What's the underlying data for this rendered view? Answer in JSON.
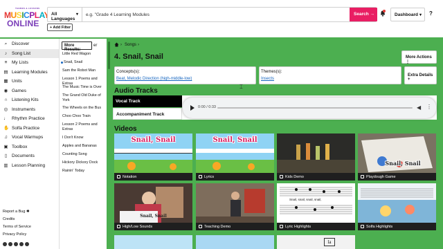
{
  "header": {
    "logo_small": "THEMES & LESSONS",
    "logo_line1": [
      "M",
      "U",
      "S",
      "I",
      "C",
      "P",
      "L",
      "A",
      "Y"
    ],
    "logo_line2": "ONLINE",
    "language": "All Languages",
    "search_value": "e.g. \"Grade 4 Learning Modules",
    "search_button": "Search →",
    "add_filter": "+ Add Filter",
    "dashboard": "Dashboard",
    "help": "?"
  },
  "sidebar": {
    "items": [
      {
        "label": "Discover",
        "icon": "search-icon",
        "glyph": "⌕"
      },
      {
        "label": "Song List",
        "icon": "music-note-icon",
        "glyph": "♪"
      },
      {
        "label": "My Lists",
        "icon": "list-icon",
        "glyph": "≡"
      },
      {
        "label": "Learning Modules",
        "icon": "modules-icon",
        "glyph": "▤"
      },
      {
        "label": "Units",
        "icon": "units-icon",
        "glyph": "▦"
      },
      {
        "label": "Games",
        "icon": "gamepad-icon",
        "glyph": "◉"
      },
      {
        "label": "Listening Kits",
        "icon": "headphones-icon",
        "glyph": "∩"
      },
      {
        "label": "Instruments",
        "icon": "drum-icon",
        "glyph": "◎"
      },
      {
        "label": "Rhythm Practice",
        "icon": "rhythm-icon",
        "glyph": "♩"
      },
      {
        "label": "Solfa Practice",
        "icon": "hand-icon",
        "glyph": "✋"
      },
      {
        "label": "Vocal Warmups",
        "icon": "microphone-icon",
        "glyph": "♫"
      },
      {
        "label": "Toolbox",
        "icon": "toolbox-icon",
        "glyph": "▣"
      },
      {
        "label": "Documents",
        "icon": "document-icon",
        "glyph": "▯"
      },
      {
        "label": "Lesson Planning",
        "icon": "calendar-icon",
        "glyph": "▥"
      }
    ],
    "links": [
      "Report a Bug",
      "Credits",
      "Terms of Service",
      "Privacy Policy"
    ]
  },
  "results": {
    "header": "More Results:",
    "header_tail": "er",
    "items": [
      "Little Red Wagon",
      "Snail, Snail",
      "Sam the Robot Man",
      "Lesson 1 Poems and Extras",
      "The Music Time is Over",
      "The Grand Old Duke of York",
      "The Wheels on the Bus",
      "Choo Choo Train",
      "Lesson 2 Poems and Extras",
      "I Don't Know",
      "Apples and Bananas",
      "Counting Song",
      "Hickory Dickory Dock",
      "Rainin' Today"
    ],
    "selected_index": 1
  },
  "main": {
    "breadcrumb": "Songs",
    "title": "4. Snail, Snail",
    "more_actions": "More Actions ⋮",
    "concepts_label": "Concepts(s):",
    "concepts_value": "Beat, Melodic Direction (high-middle-low)",
    "themes_label": "Themes(s):",
    "themes_value": "Insects",
    "extra_details": "Extra Details +",
    "audio_title": "Audio Tracks",
    "tracks": [
      "Vocal Track",
      "Accompaniment Track"
    ],
    "player_time": "0:00 / 0:33",
    "player_progress": 0.0,
    "videos_title": "Videos",
    "videos": [
      {
        "label": "Notation",
        "overlay": "Snail, Snail"
      },
      {
        "label": "Lyrics",
        "overlay": "Snail, Snail"
      },
      {
        "label": "Kids Demo",
        "overlay": ""
      },
      {
        "label": "Playdough Game",
        "overlay": "Snail, Snail"
      },
      {
        "label": "High/Low Sounds",
        "overlay": "Snail, Snail"
      },
      {
        "label": "Teaching Demo",
        "overlay": ""
      },
      {
        "label": "Lyric Highlights",
        "overlay": ""
      },
      {
        "label": "Solfa Highlights",
        "overlay": ""
      }
    ],
    "lyric_text": "Snail, snail, snail, snail,"
  },
  "colors": {
    "background": "#4caf50",
    "accent_pink": "#e91e63",
    "link_blue": "#1565c0"
  }
}
